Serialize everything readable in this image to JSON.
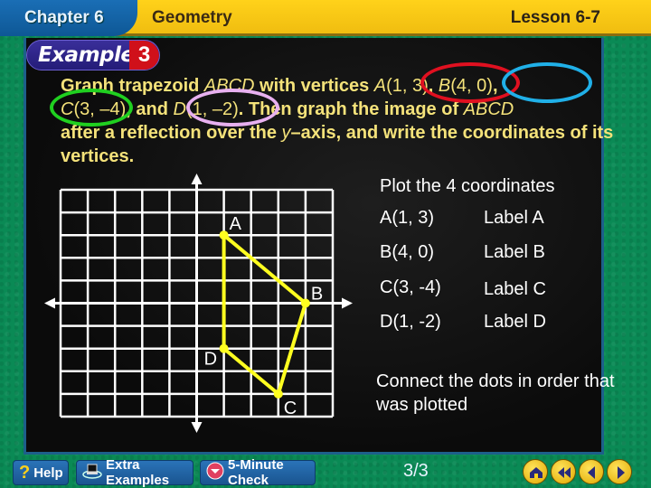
{
  "header": {
    "chapter": "Chapter 6",
    "subject": "Geometry",
    "lesson": "Lesson 6-7"
  },
  "example": {
    "word": "Example",
    "number": "3"
  },
  "problem": {
    "p1": "Graph trapezoid ",
    "abcd1": "ABCD",
    "p2": " with vertices ",
    "a": "A",
    "a_coords": "(1, 3)",
    "comma1": ", ",
    "b": "B",
    "b_coords": "(4, 0)",
    "comma2": ",",
    "c": "C",
    "c_coords": "(3, –4)",
    "p3": ", and ",
    "d": "D",
    "d_coords": "(1, –2)",
    "p4": ". Then graph the image of ",
    "abcd2": "ABCD",
    "p5": " after a reflection over the ",
    "y": "y",
    "p6": "–axis, and write the coordinates of its vertices."
  },
  "highlight_colors": {
    "A": "#e01020",
    "B": "#20b0e8",
    "C": "#20d020",
    "D": "#e8b0f0"
  },
  "instructions": {
    "title": "Plot the 4 coordinates",
    "rows": [
      {
        "coord": "A(1, 3)",
        "label": "Label A"
      },
      {
        "coord": "B(4, 0)",
        "label": "Label B"
      },
      {
        "coord": "C(3, -4)",
        "label": "Label C"
      },
      {
        "coord": "D(1, -2)",
        "label": "Label D"
      }
    ],
    "connect": "Connect the dots in order that was plotted"
  },
  "chart_data": {
    "type": "scatter",
    "title": "",
    "xlabel": "",
    "ylabel": "",
    "xlim": [
      -5,
      5
    ],
    "ylim": [
      -5,
      5
    ],
    "grid": true,
    "points": [
      {
        "label": "A",
        "x": 1,
        "y": 3
      },
      {
        "label": "B",
        "x": 4,
        "y": 0
      },
      {
        "label": "C",
        "x": 3,
        "y": -4
      },
      {
        "label": "D",
        "x": 1,
        "y": -2
      }
    ],
    "polygon_order": [
      "A",
      "B",
      "C",
      "D"
    ],
    "polygon_color": "#ffff20"
  },
  "footer": {
    "help": "Help",
    "extra_examples": "Extra Examples",
    "five_minute_check": "5-Minute Check",
    "page": "3/3",
    "nav": [
      "home",
      "first",
      "previous",
      "next"
    ]
  }
}
